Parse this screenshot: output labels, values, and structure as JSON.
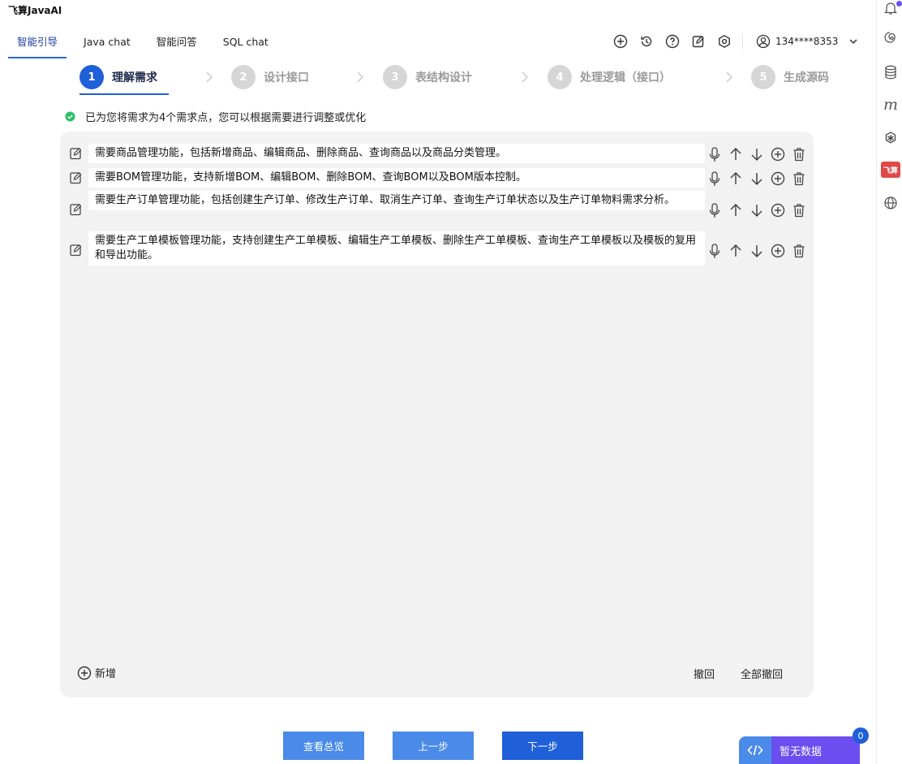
{
  "app": {
    "title": "飞算JavaAI"
  },
  "tabs": [
    {
      "label": "智能引导",
      "active": true
    },
    {
      "label": "Java chat"
    },
    {
      "label": "智能问答"
    },
    {
      "label": "SQL chat"
    }
  ],
  "toolbar": {
    "icons": [
      "add-circle-icon",
      "history-icon",
      "help-icon",
      "edit-icon",
      "settings-icon"
    ],
    "user": "134****8353"
  },
  "steps": [
    {
      "num": "1",
      "label": "理解需求",
      "active": true
    },
    {
      "num": "2",
      "label": "设计接口"
    },
    {
      "num": "3",
      "label": "表结构设计"
    },
    {
      "num": "4",
      "label": "处理逻辑（接口）"
    },
    {
      "num": "5",
      "label": "生成源码"
    }
  ],
  "notice": "已为您将需求为4个需求点，您可以根据需要进行调整或优化",
  "requirements": [
    "需要商品管理功能，包括新增商品、编辑商品、删除商品、查询商品以及商品分类管理。",
    "需要BOM管理功能，支持新增BOM、编辑BOM、删除BOM、查询BOM以及BOM版本控制。",
    "需要生产订单管理功能，包括创建生产订单、修改生产订单、取消生产订单、查询生产订单状态以及生产订单物料需求分析。",
    "需要生产工单模板管理功能，支持创建生产工单模板、编辑生产工单模板、删除生产工单模板、查询生产工单模板以及模板的复用和导出功能。"
  ],
  "panel": {
    "add": "新增",
    "undo": "撤回",
    "undo_all": "全部撤回"
  },
  "buttons": {
    "overview": "查看总览",
    "prev": "上一步",
    "next": "下一步"
  },
  "floating": {
    "data_label": "暂无数据",
    "badge": "0"
  },
  "rail": {
    "fs_label": "飞算"
  },
  "colors": {
    "primary": "#1f5fd8",
    "secondary": "#4a8ae8",
    "success": "#2bbf6a",
    "purple": "#6b4ef0",
    "panel": "#f2f2f2"
  }
}
